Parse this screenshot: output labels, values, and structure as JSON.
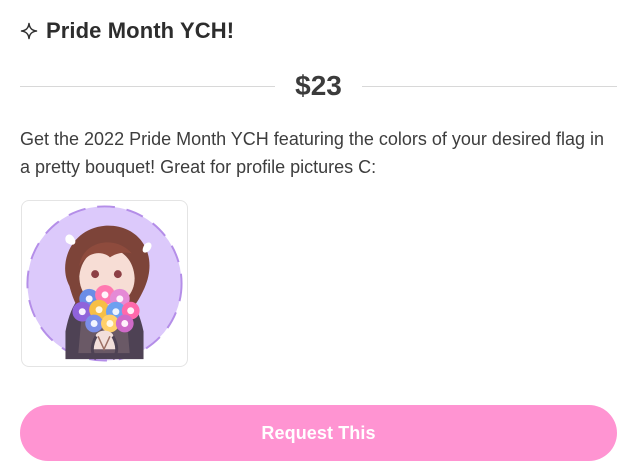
{
  "title": {
    "icon": "sparkle-icon",
    "text": "Pride Month YCH!"
  },
  "price": {
    "text": "$23"
  },
  "description": {
    "text": "Get the 2022 Pride Month YCH featuring the colors of your desired flag in a pretty bouquet! Great for profile pictures C:"
  },
  "thumbnail": {
    "semantic": "pride-bouquet-artwork"
  },
  "actions": {
    "request_label": "Request This"
  },
  "colors": {
    "accent": "#ff94d2",
    "text": "#2f2f2f",
    "divider": "#d8d8d8",
    "thumbnail_bg": "#d9c8f7"
  }
}
